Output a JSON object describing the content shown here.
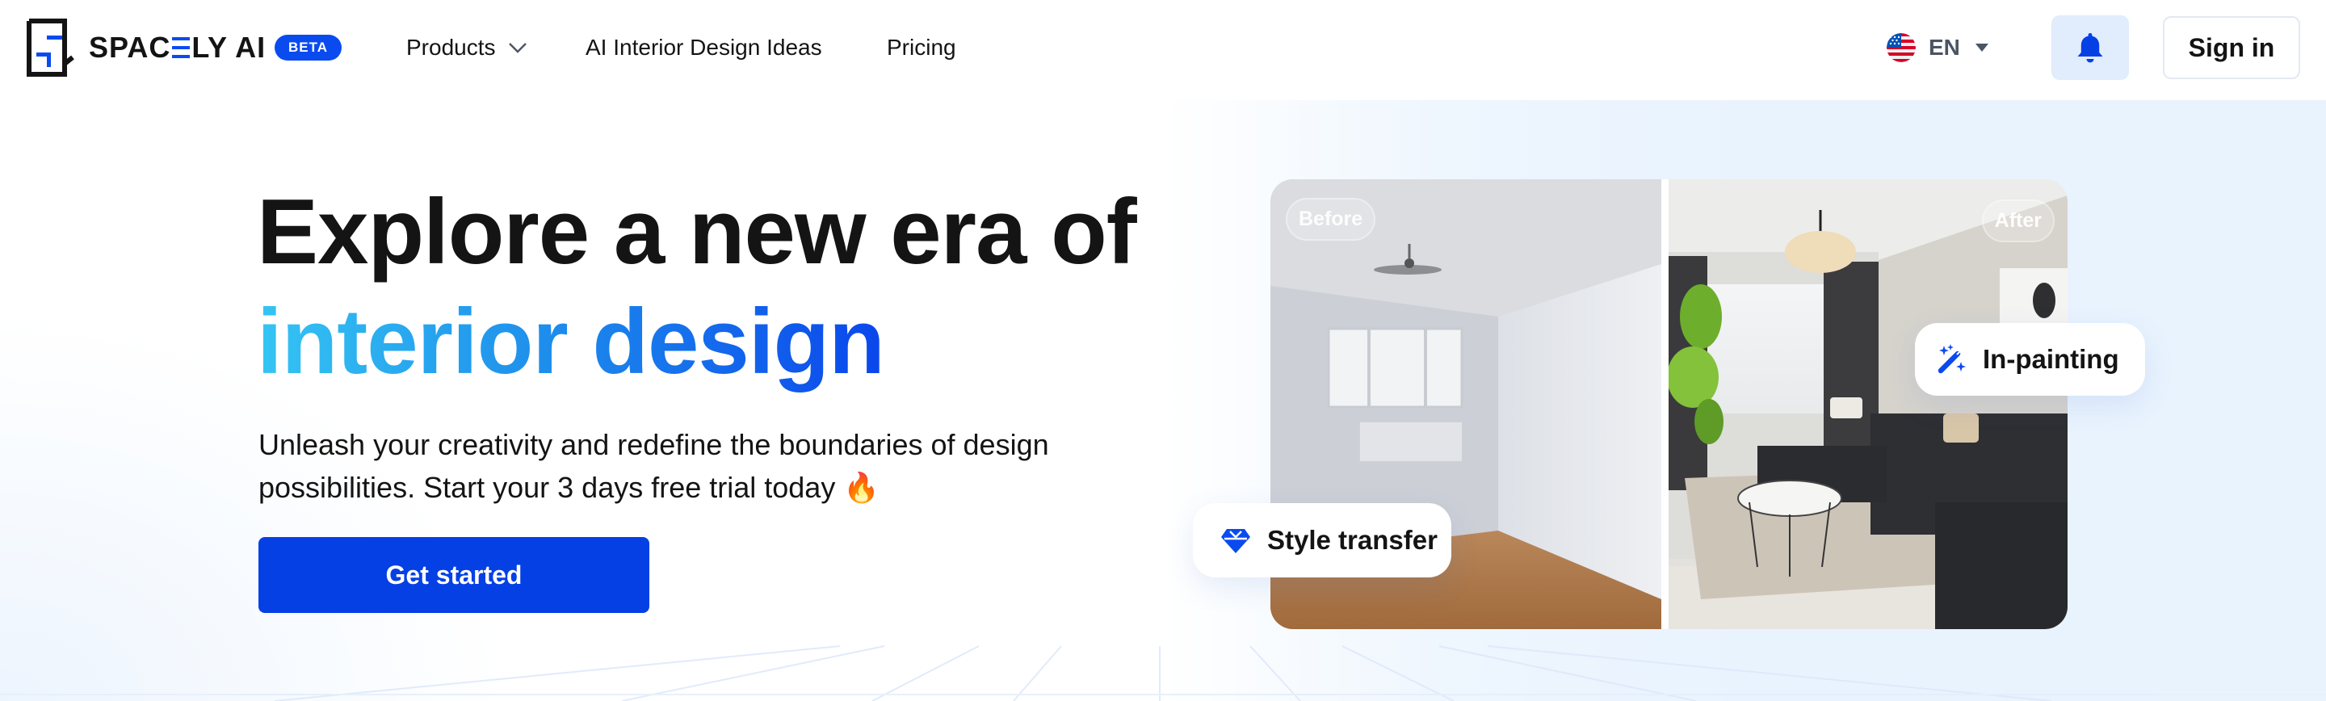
{
  "header": {
    "brand": {
      "name_prefix": "SPAC",
      "name_suffix": "LY AI",
      "badge": "BETA",
      "logo_icon": "floorplan-s-logo-icon"
    },
    "nav": [
      {
        "label": "Products",
        "has_dropdown": true
      },
      {
        "label": "AI Interior Design Ideas"
      },
      {
        "label": "Pricing"
      }
    ],
    "language": {
      "code": "EN",
      "flag": "us-flag-icon"
    },
    "notifications_icon": "bell-icon",
    "sign_in_label": "Sign in"
  },
  "hero": {
    "headline_line1": "Explore a new era of",
    "headline_line2": "interior design",
    "subtext": "Unleash your creativity and redefine the boundaries of design possibilities. Start your 3 days free trial today 🔥",
    "cta_label": "Get started"
  },
  "comparison": {
    "before_label": "Before",
    "after_label": "After",
    "features": [
      {
        "label": "Style transfer",
        "icon": "diamond-icon"
      },
      {
        "label": "In-painting",
        "icon": "magic-wand-icon"
      }
    ]
  },
  "colors": {
    "brand_blue": "#0A4BF0",
    "cta_blue": "#0540E5",
    "gradient_start": "#35C5F3",
    "gradient_end": "#0A46EC",
    "text_dark": "#141414",
    "bell_bg": "#E1ECFC",
    "hero_bg_right": "#E9F3FE"
  }
}
